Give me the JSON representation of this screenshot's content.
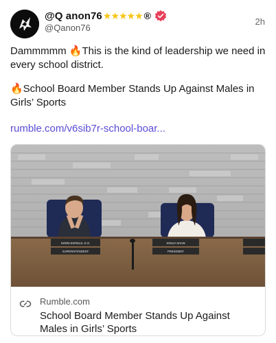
{
  "post": {
    "display_name": "@Q anon76",
    "stars": "★★★★★",
    "registered": "®",
    "handle": "@Qanon76",
    "time": "2h",
    "text_line1": "Dammmmm 🔥This is the kind of leadership we need in every school district.",
    "text_line2": "🔥School Board Member Stands Up Against Males in Girls’ Sports",
    "link": "rumble.com/v6sib7r-school-boar..."
  },
  "card": {
    "domain": "Rumble.com",
    "title": "School Board Member Stands Up Against Males in Girls’ Sports",
    "nameplates": {
      "left_name": "NORM ENFIELD, D.O.",
      "left_role": "SUPERINTENDENT",
      "right_name": "SONJA SHAW",
      "right_role": "PRESIDENT"
    }
  },
  "icons": {
    "avatar": "avatar-icon",
    "verified": "verified-badge-icon",
    "link": "link-icon"
  },
  "colors": {
    "link": "#5b4bd6",
    "star": "#f5c518",
    "verified": "#e8405a"
  }
}
